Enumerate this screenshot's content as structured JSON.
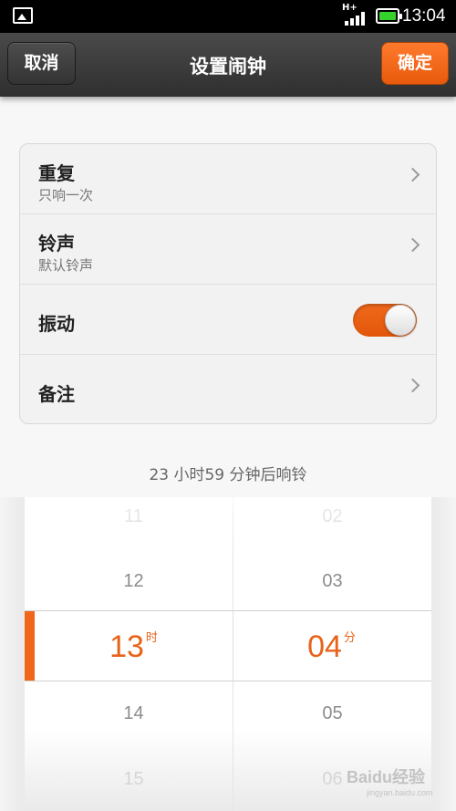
{
  "status_bar": {
    "network": "H+",
    "time": "13:04",
    "icons": [
      "image-icon",
      "signal-icon",
      "battery-icon"
    ]
  },
  "header": {
    "cancel_label": "取消",
    "title": "设置闹钟",
    "confirm_label": "确定"
  },
  "settings": {
    "repeat": {
      "label": "重复",
      "value": "只响一次"
    },
    "ringtone": {
      "label": "铃声",
      "value": "默认铃声"
    },
    "vibrate": {
      "label": "振动",
      "enabled": true
    },
    "note": {
      "label": "备注"
    }
  },
  "countdown": "23 小时59 分钟后响铃",
  "picker": {
    "hours": [
      "11",
      "12",
      "13",
      "14",
      "15"
    ],
    "minutes": [
      "02",
      "03",
      "04",
      "05",
      "06"
    ],
    "selected_hour": "13",
    "selected_minute": "04",
    "hour_unit": "时",
    "minute_unit": "分"
  },
  "watermark": {
    "text": "Baidu经验",
    "sub": "jingyan.baidu.com"
  },
  "colors": {
    "accent": "#f0661a",
    "titlebar": "#3a3a3a",
    "toggle_on": "#e8601a"
  }
}
